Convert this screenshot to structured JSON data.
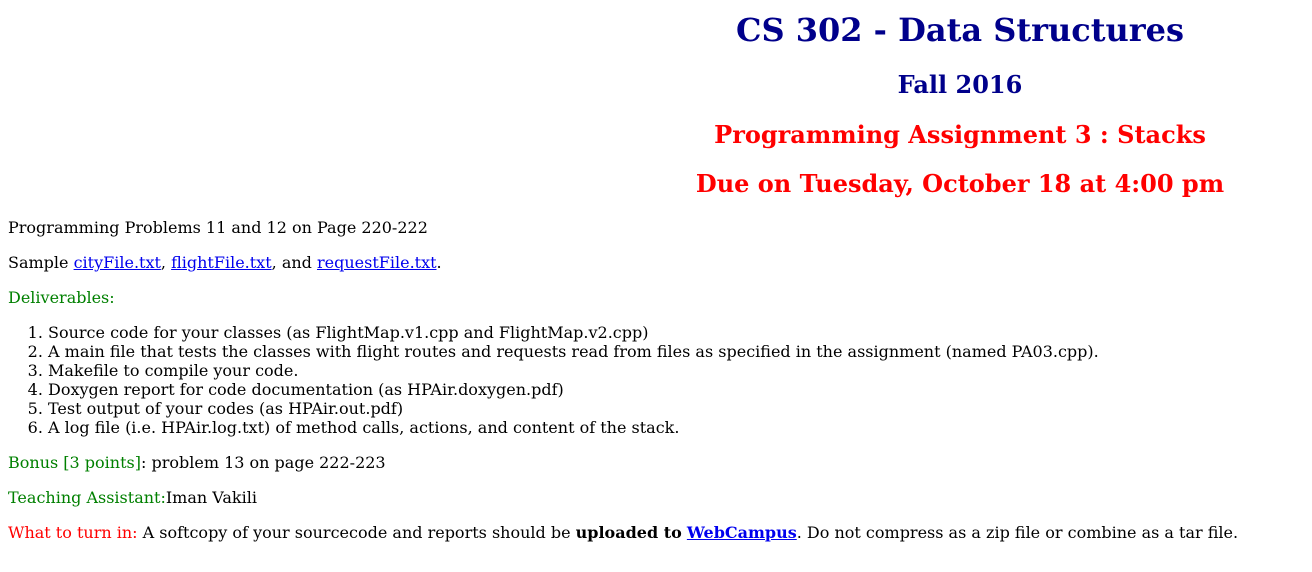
{
  "header": {
    "course": "CS 302 - Data Structures",
    "term": "Fall 2016",
    "assignment": "Programming Assignment 3 : Stacks",
    "due": "Due on Tuesday, October 18 at 4:00 pm"
  },
  "problems": "Programming Problems 11 and 12 on Page 220-222",
  "sample": {
    "prefix": "Sample ",
    "link1": "cityFile.txt",
    "sep1": ", ",
    "link2": "flightFile.txt",
    "sep2": ", and ",
    "link3": "requestFile.txt",
    "suffix": "."
  },
  "deliverables": {
    "label": "Deliverables:",
    "items": [
      "Source code for your classes (as FlightMap.v1.cpp and FlightMap.v2.cpp)",
      "A main file that tests the classes with flight routes and requests read from files as specified in the assignment (named PA03.cpp).",
      "Makefile to compile your code.",
      "Doxygen report for code documentation (as HPAir.doxygen.pdf)",
      "Test output of your codes (as HPAir.out.pdf)",
      "A log file (i.e. HPAir.log.txt) of method calls, actions, and content of the stack."
    ]
  },
  "bonus": {
    "label": "Bonus [3 points]",
    "text": ": problem 13 on page 222-223"
  },
  "ta": {
    "label": "Teaching Assistant:",
    "name": "Iman Vakili"
  },
  "turnin": {
    "label": "What to turn in:",
    "text1": " A softcopy of your sourcecode and reports should be ",
    "bold": "uploaded to",
    "space": " ",
    "link": "WebCampus",
    "text2": ". Do not compress as a zip file or combine as a tar file."
  },
  "colors": {
    "heading_blue": "#00008b",
    "heading_red": "#ff0000",
    "label_green": "#008000",
    "label_red": "#ff0000",
    "link": "#0000ee"
  }
}
